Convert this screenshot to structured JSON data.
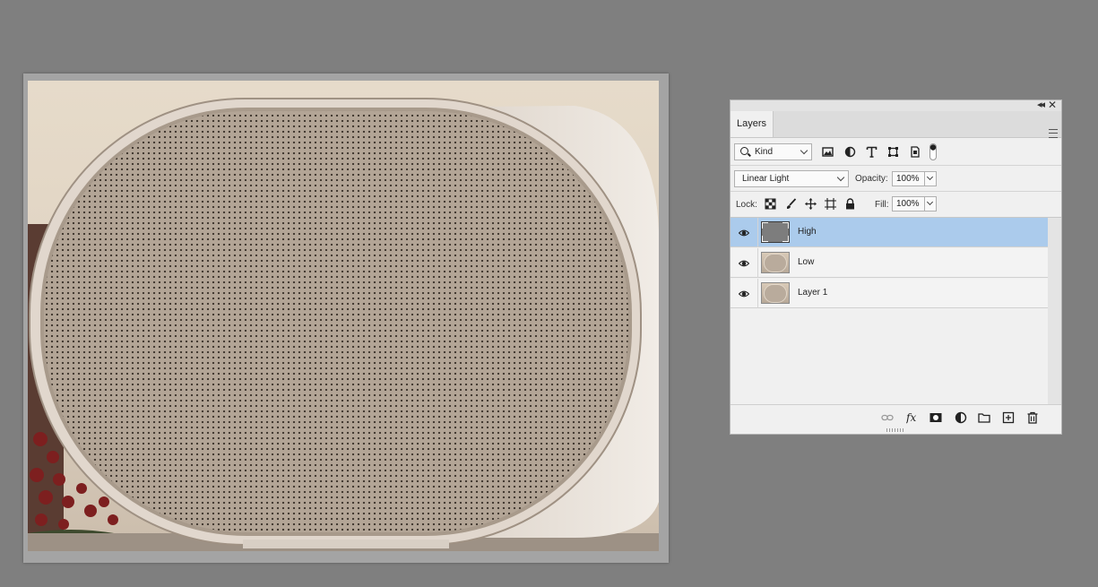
{
  "document": {
    "image_description_hidden": ""
  },
  "panel": {
    "tab_label": "Layers",
    "filter": {
      "kind_label": "Kind"
    },
    "blend": {
      "mode": "Linear Light",
      "opacity_label": "Opacity:",
      "opacity_value": "100%"
    },
    "lock": {
      "lock_label": "Lock:",
      "fill_label": "Fill:",
      "fill_value": "100%"
    },
    "layers": [
      {
        "name": "High",
        "selected": true,
        "visible": true,
        "thumbnail": "gray"
      },
      {
        "name": "Low",
        "selected": false,
        "visible": true,
        "thumbnail": "photo"
      },
      {
        "name": "Layer 1",
        "selected": false,
        "visible": true,
        "thumbnail": "photo"
      }
    ],
    "bottom_icons": [
      "link-icon",
      "fx-icon",
      "mask-icon",
      "adjustment-icon",
      "folder-icon",
      "new-layer-icon",
      "trash-icon"
    ]
  },
  "colors": {
    "workspace": "#7f7f7f",
    "selected_row": "#abcbec",
    "panel_bg": "#f0f0f0"
  }
}
